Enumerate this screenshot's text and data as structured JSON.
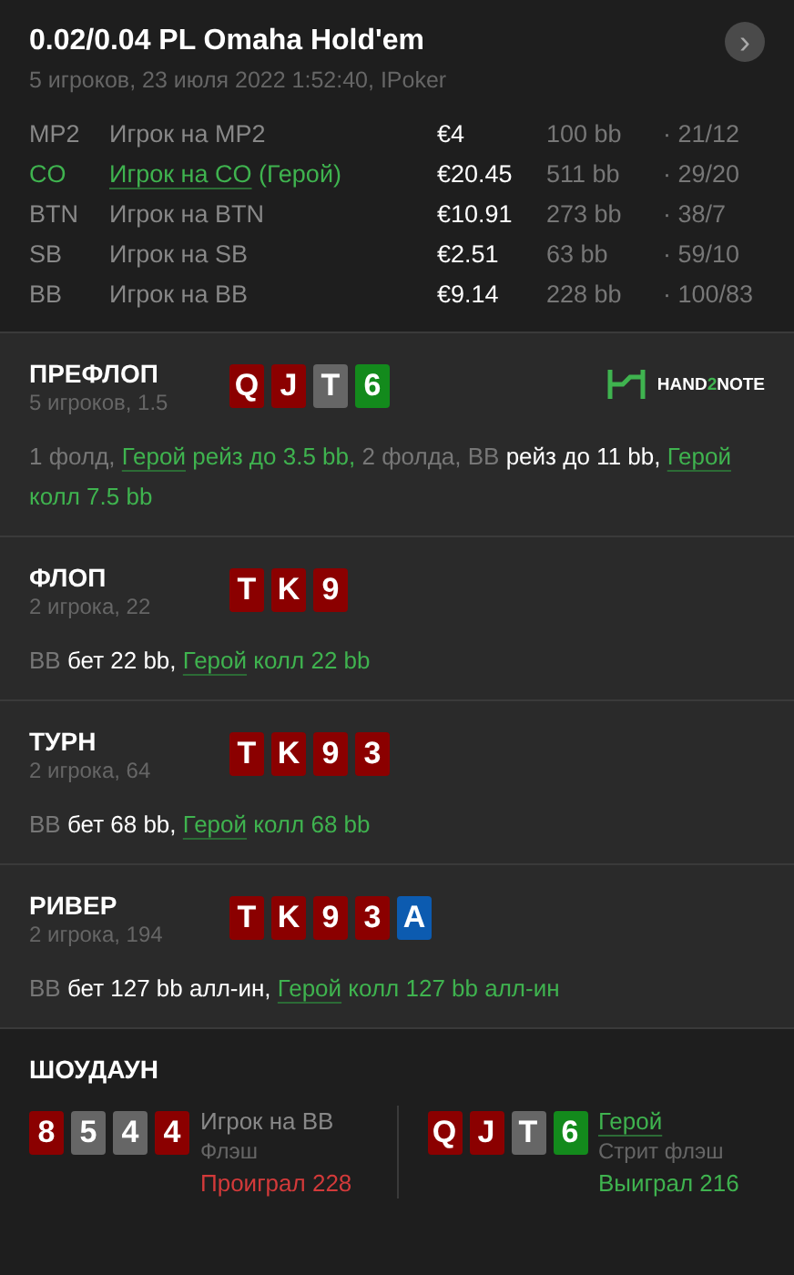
{
  "header": {
    "title": "0.02/0.04 PL Omaha Hold'em",
    "subtitle": "5 игроков, 23 июля 2022 1:52:40, IPoker",
    "next": "›"
  },
  "players": [
    {
      "position": "MP2",
      "name": "Игрок на MP2",
      "hero": false,
      "stack": "€4",
      "bb": "100 bb",
      "stats": "· 21/12"
    },
    {
      "position": "CO",
      "name": "Игрок на CO",
      "hero_tag": "(Герой)",
      "hero": true,
      "stack": "€20.45",
      "bb": "511 bb",
      "stats": "· 29/20"
    },
    {
      "position": "BTN",
      "name": "Игрок на BTN",
      "hero": false,
      "stack": "€10.91",
      "bb": "273 bb",
      "stats": "· 38/7"
    },
    {
      "position": "SB",
      "name": "Игрок на SB",
      "hero": false,
      "stack": "€2.51",
      "bb": "63 bb",
      "stats": "· 59/10"
    },
    {
      "position": "BB",
      "name": "Игрок на BB",
      "hero": false,
      "stack": "€9.14",
      "bb": "228 bb",
      "stats": "· 100/83"
    }
  ],
  "logo": {
    "parts": [
      "HAND",
      "2",
      "NOTE"
    ]
  },
  "streets": [
    {
      "name": "ПРЕФЛОП",
      "info": "5 игроков, 1.5",
      "logo": true,
      "cards": [
        {
          "rank": "Q",
          "color": "#8b0000"
        },
        {
          "rank": "J",
          "color": "#8b0000"
        },
        {
          "rank": "T",
          "color": "#666666"
        },
        {
          "rank": "6",
          "color": "#138a1c"
        }
      ],
      "actions": [
        {
          "kind": "muted",
          "text": "1 фолд,"
        },
        {
          "kind": "hero",
          "text": "Герой"
        },
        {
          "kind": "hero_action",
          "text": "рейз до 3.5 bb,"
        },
        {
          "kind": "muted",
          "text": "2 фолда, BB"
        },
        {
          "kind": "action",
          "text": "рейз до 11 bb,"
        },
        {
          "kind": "hero",
          "text": "Герой"
        },
        {
          "kind": "hero_action",
          "text": "колл 7.5 bb"
        }
      ]
    },
    {
      "name": "ФЛОП",
      "info": "2 игрока, 22",
      "logo": false,
      "cards": [
        {
          "rank": "T",
          "color": "#8b0000"
        },
        {
          "rank": "K",
          "color": "#8b0000"
        },
        {
          "rank": "9",
          "color": "#8b0000"
        }
      ],
      "actions": [
        {
          "kind": "muted",
          "text": "BB"
        },
        {
          "kind": "action",
          "text": "бет 22 bb,"
        },
        {
          "kind": "hero",
          "text": "Герой"
        },
        {
          "kind": "hero_action",
          "text": "колл 22 bb"
        }
      ]
    },
    {
      "name": "ТУРН",
      "info": "2 игрока, 64",
      "logo": false,
      "cards": [
        {
          "rank": "T",
          "color": "#8b0000"
        },
        {
          "rank": "K",
          "color": "#8b0000"
        },
        {
          "rank": "9",
          "color": "#8b0000"
        },
        {
          "rank": "3",
          "color": "#8b0000"
        }
      ],
      "actions": [
        {
          "kind": "muted",
          "text": "BB"
        },
        {
          "kind": "action",
          "text": "бет 68 bb,"
        },
        {
          "kind": "hero",
          "text": "Герой"
        },
        {
          "kind": "hero_action",
          "text": "колл 68 bb"
        }
      ]
    },
    {
      "name": "РИВЕР",
      "info": "2 игрока, 194",
      "logo": false,
      "cards": [
        {
          "rank": "T",
          "color": "#8b0000"
        },
        {
          "rank": "K",
          "color": "#8b0000"
        },
        {
          "rank": "9",
          "color": "#8b0000"
        },
        {
          "rank": "3",
          "color": "#8b0000"
        },
        {
          "rank": "A",
          "color": "#0c5bb0"
        }
      ],
      "actions": [
        {
          "kind": "muted",
          "text": "BB"
        },
        {
          "kind": "action",
          "text": "бет 127 bb алл-ин,"
        },
        {
          "kind": "hero",
          "text": "Герой"
        },
        {
          "kind": "hero_action",
          "text": "колл 127 bb алл-ин"
        }
      ]
    }
  ],
  "showdown": {
    "title": "ШОУДАУН",
    "hands": [
      {
        "player": "Игрок на BB",
        "hero": false,
        "combo": "Флэш",
        "result": "Проиграл 228",
        "won": false,
        "cards": [
          {
            "rank": "8",
            "color": "#8b0000"
          },
          {
            "rank": "5",
            "color": "#666666"
          },
          {
            "rank": "4",
            "color": "#666666"
          },
          {
            "rank": "4",
            "color": "#8b0000"
          }
        ]
      },
      {
        "player": "Герой",
        "hero": true,
        "combo": "Стрит флэш",
        "result": "Выиграл 216",
        "won": true,
        "cards": [
          {
            "rank": "Q",
            "color": "#8b0000"
          },
          {
            "rank": "J",
            "color": "#8b0000"
          },
          {
            "rank": "T",
            "color": "#666666"
          },
          {
            "rank": "6",
            "color": "#138a1c"
          }
        ]
      }
    ]
  }
}
